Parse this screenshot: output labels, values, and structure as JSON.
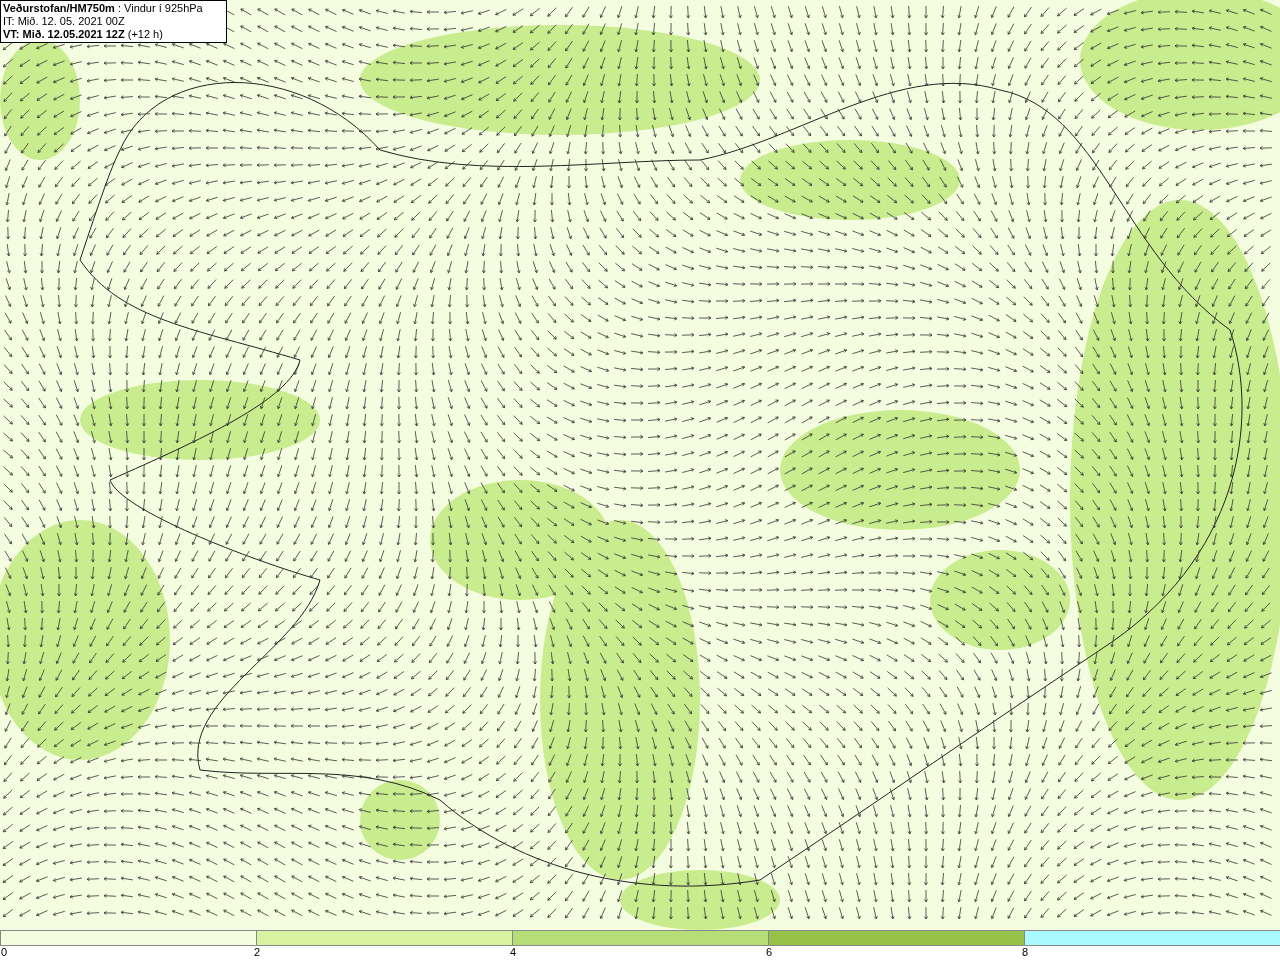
{
  "title_box": {
    "lines": [
      "**Veðurstofan/HM750m** : Vindur í 925hPa",
      "IT: Mið. 12. 05. 2021 00Z",
      "**VT: Mið. 12.05.2021 12Z** (+12 h)"
    ]
  },
  "legend": {
    "segments": [
      {
        "color": "#f5fde0"
      },
      {
        "color": "#d7f3a0"
      },
      {
        "color": "#b5de77"
      },
      {
        "color": "#97c24a"
      },
      {
        "color": "#aaf9ff"
      }
    ],
    "ticks": [
      "0",
      "2",
      "4",
      "6",
      "8"
    ]
  }
}
